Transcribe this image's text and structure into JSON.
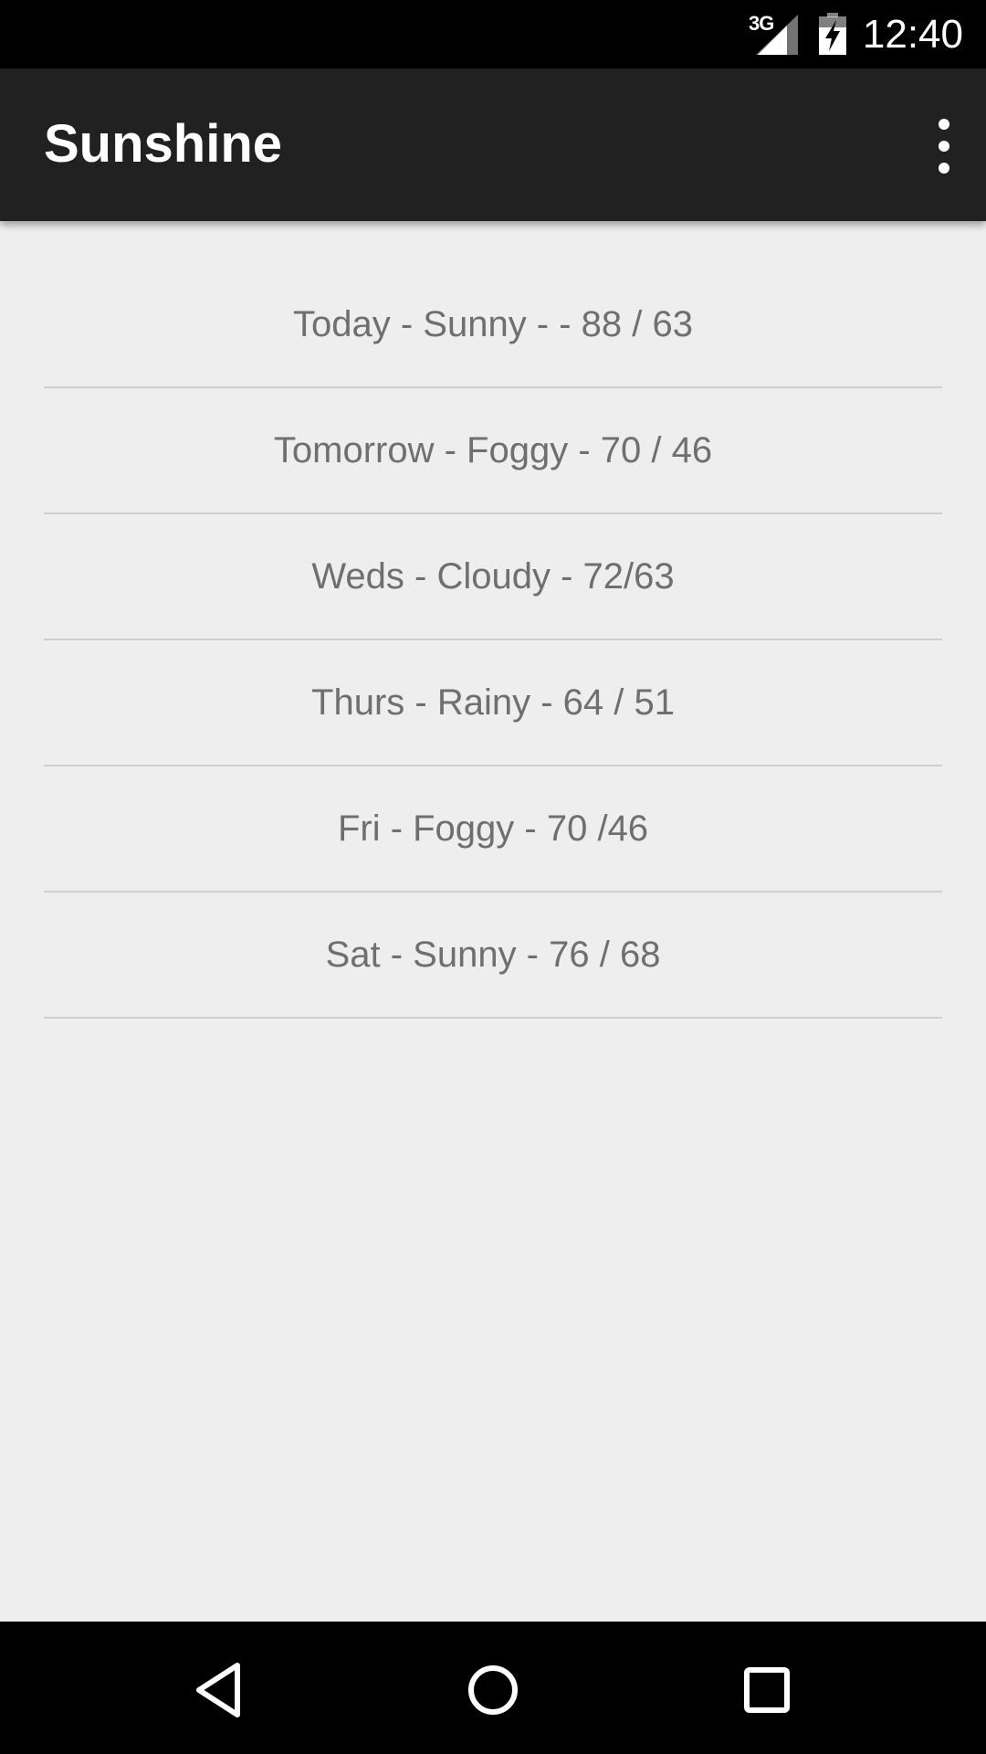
{
  "status_bar": {
    "network": "3G",
    "time": "12:40",
    "icons": [
      "signal-icon",
      "battery-charging-icon"
    ]
  },
  "app_bar": {
    "title": "Sunshine",
    "overflow_icon": "more-vert-icon"
  },
  "forecast": [
    "Today - Sunny - - 88 / 63",
    "Tomorrow - Foggy - 70 / 46",
    "Weds - Cloudy - 72/63",
    "Thurs - Rainy - 64 / 51",
    "Fri - Foggy - 70 /46",
    "Sat - Sunny - 76 / 68"
  ],
  "nav_bar": {
    "icons": [
      "back-icon",
      "home-icon",
      "recent-apps-icon"
    ]
  },
  "colors": {
    "status_bar": "#000000",
    "app_bar": "#212121",
    "background": "#eeeeee",
    "list_text": "#6f6f6f",
    "divider": "#cfcfcf"
  }
}
